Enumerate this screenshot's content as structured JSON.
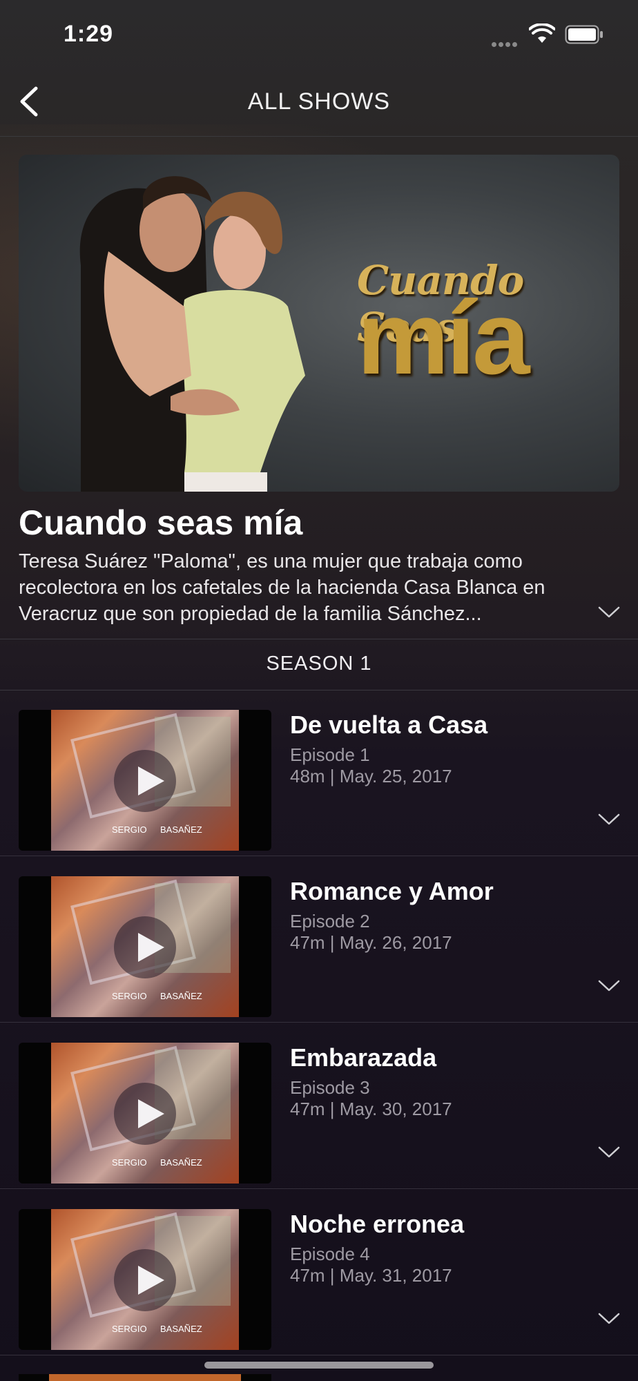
{
  "status_bar": {
    "time": "1:29"
  },
  "nav": {
    "title": "ALL SHOWS"
  },
  "hero": {
    "logo_line1": "Cuando Seas",
    "logo_line2": "mía"
  },
  "show": {
    "title": "Cuando seas mía",
    "description": "Teresa Suárez \"Paloma\", es una mujer que trabaja como recolectora en los cafetales de la hacienda Casa Blanca en Veracruz que son propiedad de la familia Sánchez..."
  },
  "season": {
    "label": "SEASON 1"
  },
  "episodes": [
    {
      "title": "De vuelta a Casa",
      "number": "Episode 1",
      "meta": "48m | May. 25, 2017",
      "credit_left": "SERGIO",
      "credit_right": "BASAÑEZ"
    },
    {
      "title": "Romance y Amor",
      "number": "Episode 2",
      "meta": "47m | May. 26, 2017",
      "credit_left": "SERGIO",
      "credit_right": "BASAÑEZ"
    },
    {
      "title": "Embarazada",
      "number": "Episode 3",
      "meta": "47m | May. 30, 2017",
      "credit_left": "SERGIO",
      "credit_right": "BASAÑEZ"
    },
    {
      "title": "Noche erronea",
      "number": "Episode 4",
      "meta": "47m | May. 31, 2017",
      "credit_left": "SERGIO",
      "credit_right": "BASAÑEZ"
    }
  ],
  "icons": {
    "back": "chevron-left-icon",
    "expand": "chevron-down-icon",
    "play": "play-icon",
    "wifi": "wifi-icon",
    "battery": "battery-icon",
    "signal": "cellular-signal-icon"
  },
  "colors": {
    "background": "#16111d",
    "text": "#ffffff",
    "muted": "#9e9aa3",
    "logo_gold": "#c49a39"
  }
}
